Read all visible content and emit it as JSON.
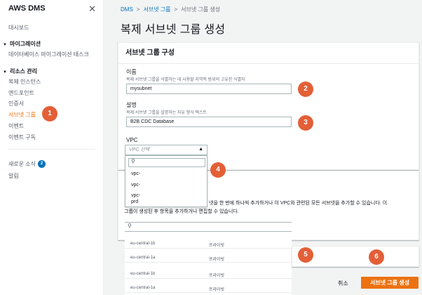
{
  "sidebar": {
    "title": "AWS DMS",
    "dashboard": "대시보드",
    "section_migration": "마이그레이션",
    "db_migration_tasks": "데이터베이스 마이그레이션 태스크",
    "section_resources": "리소스 관리",
    "replication_instances": "복제 인스턴스",
    "endpoints": "엔드포인트",
    "certificates": "인증서",
    "subnet_groups": "서브넷 그룹",
    "events": "이벤트",
    "event_subscriptions": "이벤트 구독",
    "whats_new": "새로운 소식",
    "whats_new_count": "2",
    "notifications": "알림"
  },
  "breadcrumb": {
    "root": "DMS",
    "parent": "서브넷 그룹",
    "current": "서브넷 그룹 생성"
  },
  "page_title": "복제 서브넷 그룹 생성",
  "config_panel": {
    "title": "서브넷 그룹 구성",
    "name_label": "이름",
    "name_desc": "복제 서브넷 그룹을 식별하는 데 사용할 지역적 범위의 고유한 식별자",
    "name_value": "mysubnet",
    "desc_label": "설명",
    "desc_desc": "복제 서브넷 그룹을 설명하는 자유 형식 텍스트",
    "desc_value": "B2B CDC Database",
    "vpc_label": "VPC",
    "vpc_placeholder": "VPC 선택",
    "vpc_options": [
      "vpc-",
      "vpc-",
      "vpc-",
      "prd"
    ]
  },
  "subnet_panel": {
    "line1": "넷을 한 번에 하나씩 추가하거나 이 VPC와 관련된 모든 서브넷을 추가할 수 있습니다. 이",
    "line2": "그룹이 생성된 후 항목을 추가하거나 편집할 수 있습니다.",
    "rows": [
      {
        "az": "eu-central-1b",
        "type": "프라이빗"
      },
      {
        "az": "eu-central-1a",
        "type": "프라이빗"
      },
      {
        "az": "eu-central-1b",
        "type": "프라이빗"
      },
      {
        "az": "eu-central-1a",
        "type": "프라이빗"
      }
    ]
  },
  "footer": {
    "cancel": "취소",
    "create": "서브넷 그룹 생성"
  },
  "callouts": [
    "1",
    "2",
    "3",
    "4",
    "5",
    "6"
  ],
  "colors": {
    "accent": "#ec7211",
    "callout": "#e35f37",
    "link": "#0073bb"
  }
}
